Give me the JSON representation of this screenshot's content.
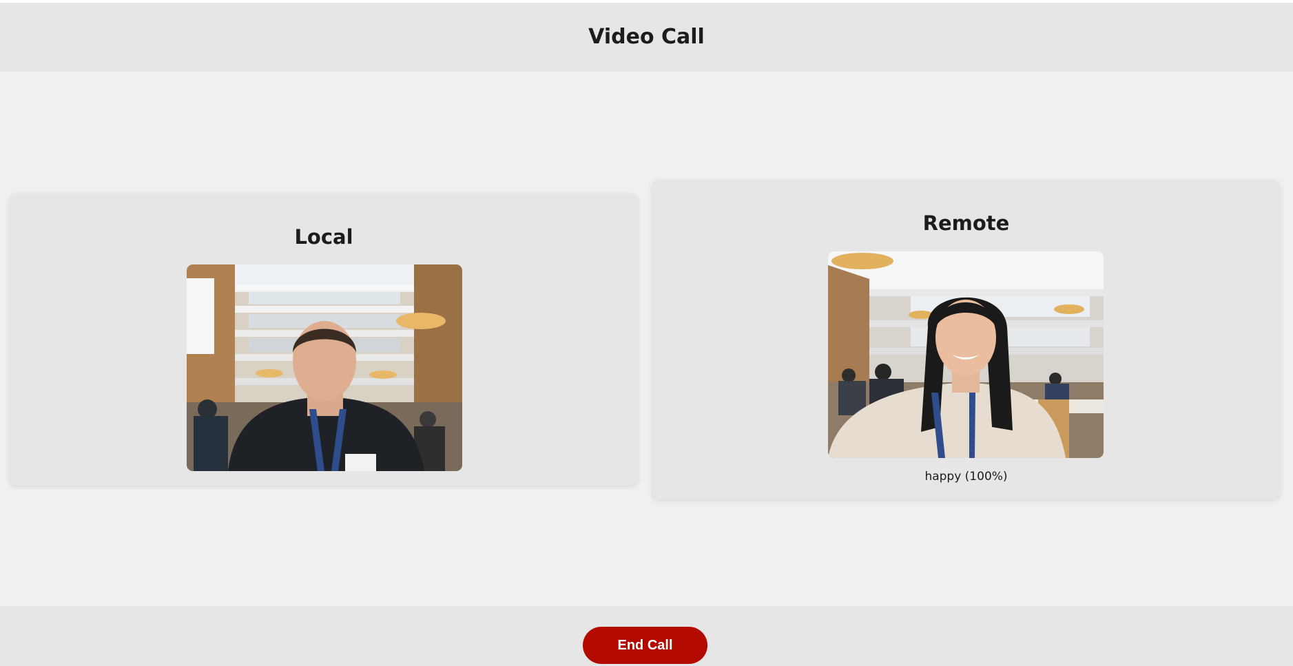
{
  "header": {
    "title": "Video Call"
  },
  "local": {
    "title": "Local"
  },
  "remote": {
    "title": "Remote",
    "emotion": "happy (100%)"
  },
  "controls": {
    "end_call_label": "End Call",
    "end_call_color": "#b30a00"
  }
}
